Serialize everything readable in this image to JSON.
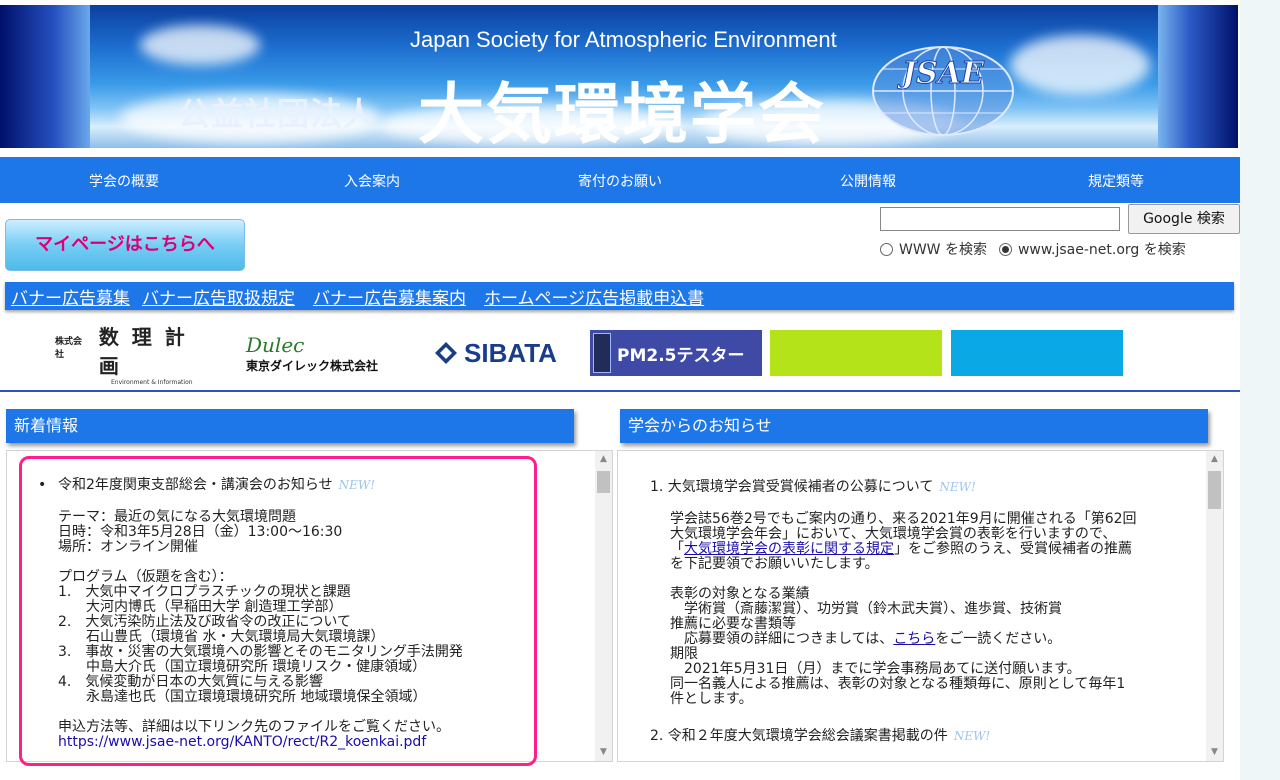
{
  "header": {
    "subtitle": "Japan Society for Atmospheric Environment",
    "kind": "公益社団法人",
    "org_name": "大気環境学会",
    "logo_text": "JSAE"
  },
  "nav": [
    "学会の概要",
    "入会案内",
    "寄付のお願い",
    "公開情報",
    "規定類等"
  ],
  "search": {
    "input_value": "",
    "button_label": "Google 検索",
    "option_www": "WWW を検索",
    "option_site": "www.jsae-net.org を検索",
    "selected": "site"
  },
  "mypage_button": "マイページはこちらへ",
  "ad_links": [
    "バナー広告募集",
    "バナー広告取扱規定",
    "バナー広告募集案内",
    "ホームページ広告掲載申込書"
  ],
  "sponsors": {
    "suuri_prefix": "株式会社",
    "suuri_name": "数 理 計 画",
    "suuri_sub": "Environment & Information",
    "dulec_script": "Dulec",
    "dulec_name": "東京ダイレック株式会社",
    "sibata": "SIBATA",
    "pm": "PM2.5テスター"
  },
  "news": {
    "heading": "新着情報",
    "new_tag": "NEW!",
    "item_title": "令和2年度関東支部総会・講演会のお知らせ",
    "lines": [
      "テーマ：最近の気になる大気環境問題",
      "日時：令和3年5月28日（金）13:00〜16:30",
      "場所：オンライン開催",
      "",
      "プログラム（仮題を含む）：",
      "1.　大気中マイクロプラスチックの現状と課題",
      "　　大河内博氏（早稲田大学 創造理工学部）",
      "2.　大気汚染防止法及び政省令の改正について",
      "　　石山豊氏（環境省 水・大気環境局大気環境課）",
      "3.　事故・災害の大気環境への影響とそのモニタリング手法開発",
      "　　中島大介氏（国立環境研究所 環境リスク・健康領域）",
      "4.　気候変動が日本の大気質に与える影響",
      "　　永島達也氏（国立環境環境研究所 地域環境保全領域）",
      "",
      "申込方法等、詳細は以下リンク先のファイルをご覧ください。"
    ],
    "link": "https://www.jsae-net.org/KANTO/rect/R2_koenkai.pdf"
  },
  "notice": {
    "heading": "学会からのお知らせ",
    "new_tag": "NEW!",
    "item1_title": "1. 大気環境学会賞受賞候補者の公募について",
    "p1": [
      "学会誌56巻2号でもご案内の通り、来る2021年9月に開催される「第62回",
      "大気環境学会年会」において、大気環境学会賞の表彰を行いますので、"
    ],
    "p1_link_pre": "「",
    "p1_link": "大気環境学会の表彰に関する規定",
    "p1_link_post": "」をご参照のうえ、受賞候補者の推薦",
    "p1_end": "を下記要領でお願いいたします。",
    "p2_a": "表彰の対象となる業績",
    "p2_b": "　学術賞（斎藤潔賞）、功労賞（鈴木武夫賞）、進歩賞、技術賞",
    "p2_c": "推薦に必要な書類等",
    "p2_d_pre": "　応募要領の詳細につきましては、",
    "p2_d_link": "こちら",
    "p2_d_post": "をご一読ください。",
    "p2_e": "期限",
    "p2_f": "　2021年5月31日（月）までに学会事務局あてに送付願います。",
    "p2_g": "同一名義人による推薦は、表彰の対象となる種類毎に、原則として毎年1",
    "p2_h": "件とします。",
    "item2_title": "2. 令和２年度大気環境学会総会議案書掲載の件"
  }
}
